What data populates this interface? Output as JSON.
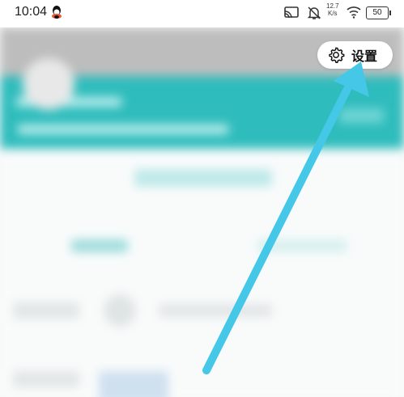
{
  "status_bar": {
    "time": "10:04",
    "net_speed_value": "12.7",
    "net_speed_unit": "K/s",
    "battery": "50"
  },
  "settings_button": {
    "label": "设置",
    "icon": "gear-icon"
  },
  "colors": {
    "accent": "#2fbcbc",
    "arrow": "#45c8e8"
  }
}
